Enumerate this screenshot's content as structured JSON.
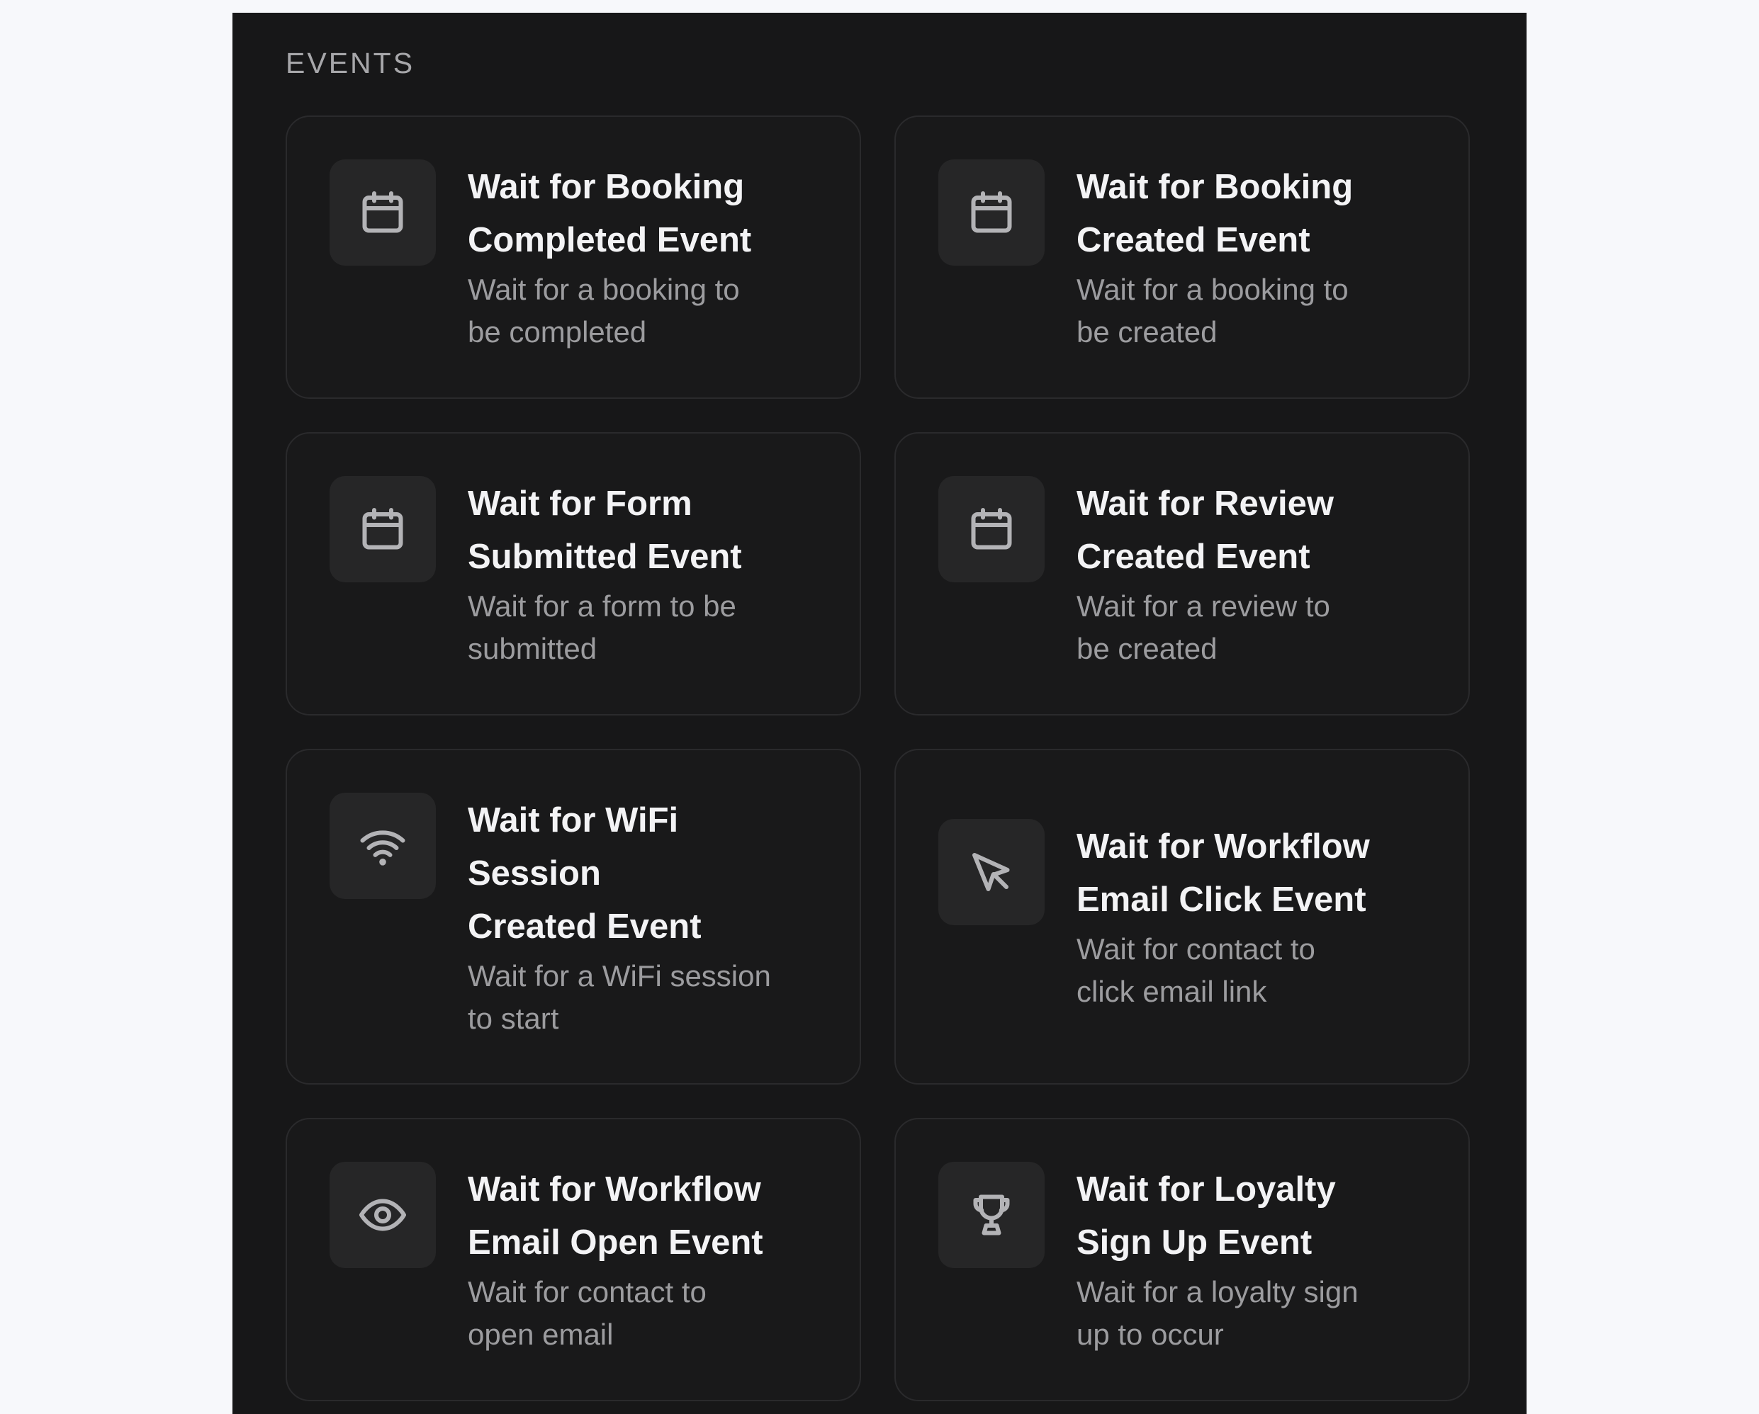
{
  "section": {
    "label": "EVENTS"
  },
  "cards": [
    {
      "icon": "calendar-icon",
      "title": "Wait for Booking\nCompleted Event",
      "description": "Wait for a booking to\nbe completed"
    },
    {
      "icon": "calendar-icon",
      "title": "Wait for Booking\nCreated Event",
      "description": "Wait for a booking to\nbe created"
    },
    {
      "icon": "calendar-icon",
      "title": "Wait for Form\nSubmitted Event",
      "description": "Wait for a form to be\nsubmitted"
    },
    {
      "icon": "calendar-icon",
      "title": "Wait for Review\nCreated Event",
      "description": "Wait for a review to\nbe created"
    },
    {
      "icon": "wifi-icon",
      "title": "Wait for WiFi\nSession\nCreated Event",
      "description": "Wait for a WiFi session\nto start"
    },
    {
      "icon": "cursor-pointer-icon",
      "title": "Wait for Workflow\nEmail Click Event",
      "description": "Wait for contact to\nclick email link"
    },
    {
      "icon": "eye-icon",
      "title": "Wait for Workflow\nEmail Open Event",
      "description": "Wait for contact to\nopen email"
    },
    {
      "icon": "trophy-icon",
      "title": "Wait for Loyalty\nSign Up Event",
      "description": "Wait for a loyalty sign\nup to occur"
    }
  ]
}
